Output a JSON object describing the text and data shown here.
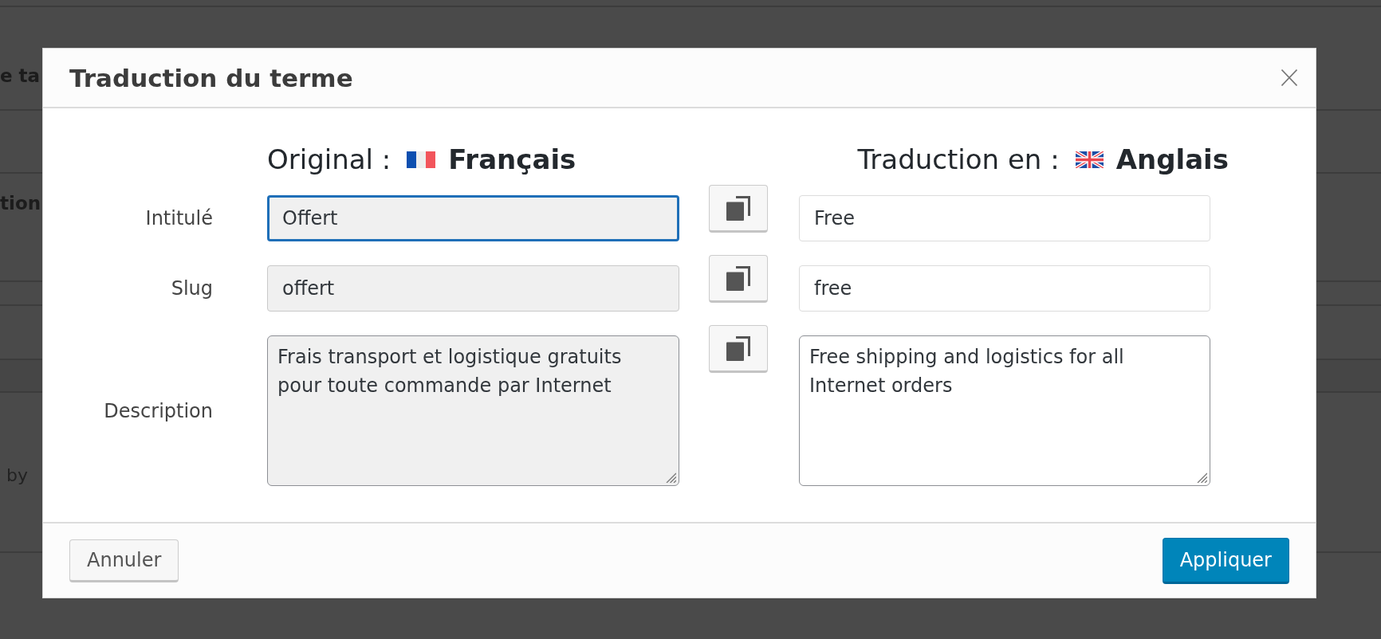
{
  "background": {
    "texts": [
      {
        "kind": "heading",
        "text": "e ta"
      },
      {
        "kind": "heading",
        "text": "tion"
      },
      {
        "kind": "text",
        "text": "by"
      }
    ]
  },
  "dialog": {
    "title": "Traduction du terme",
    "headings": [
      {
        "kind": "fr",
        "prefix": "Original :",
        "language": "Français"
      },
      {
        "kind": "gb",
        "prefix": "Traduction en :",
        "language": "Anglais"
      }
    ],
    "rows": [
      {
        "label": "Intitulé",
        "kind": "input",
        "original": {
          "value": "Offert",
          "readonly": true,
          "focused": true
        },
        "translation": {
          "value": "Free",
          "readonly": false,
          "focused": false
        }
      },
      {
        "label": "Slug",
        "kind": "input",
        "original": {
          "value": "offert",
          "readonly": true,
          "focused": false
        },
        "translation": {
          "value": "free",
          "readonly": false,
          "focused": false
        }
      },
      {
        "label": "Description",
        "kind": "textarea",
        "original": {
          "value": "Frais transport et logistique gratuits pour toute commande par Internet",
          "readonly": true,
          "focused": false
        },
        "translation": {
          "value": "Free shipping and logistics for all Internet orders",
          "readonly": false,
          "focused": false
        }
      }
    ],
    "buttons": {
      "cancel": "Annuler",
      "apply": "Appliquer"
    }
  }
}
